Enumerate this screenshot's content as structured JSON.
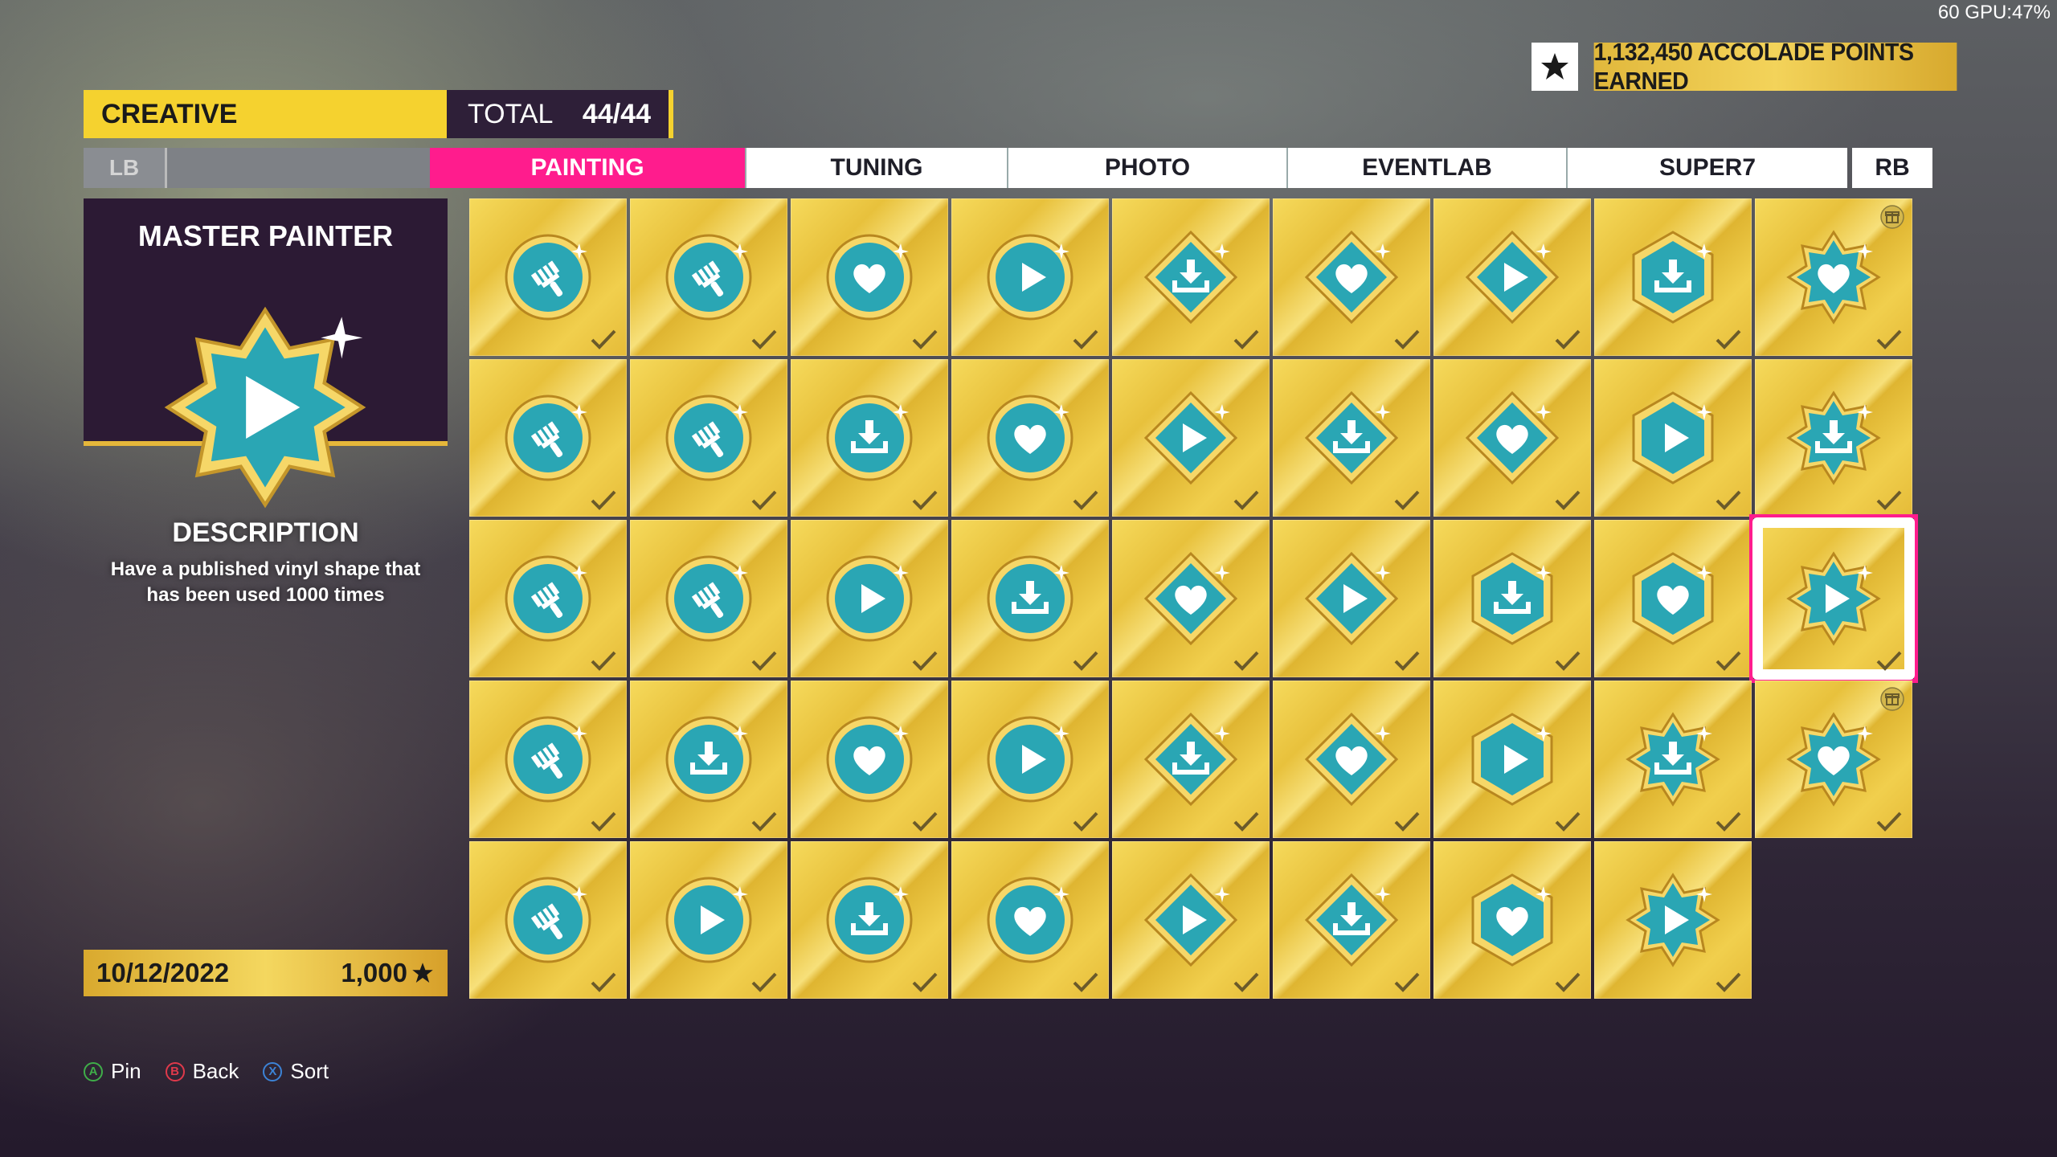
{
  "perf": "60 GPU:47%",
  "accolade": {
    "points": "1,132,450 ACCOLADE POINTS EARNED",
    "icon": "star-icon"
  },
  "category": {
    "name": "CREATIVE",
    "total_label": "TOTAL",
    "total_value": "44/44"
  },
  "tabs": {
    "left_bumper": "LB",
    "right_bumper": "RB",
    "items": [
      {
        "label": "PAINTING",
        "active": true
      },
      {
        "label": "TUNING",
        "active": false
      },
      {
        "label": "PHOTO",
        "active": false
      },
      {
        "label": "EVENTLAB",
        "active": false
      },
      {
        "label": "SUPER7",
        "active": false
      }
    ]
  },
  "detail": {
    "title": "MASTER PAINTER",
    "badge": {
      "shape": "star-hexagon",
      "icon": "play-icon"
    },
    "description_title": "DESCRIPTION",
    "description": "Have a published vinyl shape that has been used 1000 times",
    "date": "10/12/2022",
    "points": "1,000"
  },
  "colors": {
    "accent": "#ff1c8d",
    "gold": "#f5d22f",
    "badge": "#2aa6b4",
    "panel": "#2c1a34"
  },
  "grid": {
    "rows": [
      [
        {
          "shape": "circle",
          "icon": "brush",
          "complete": true
        },
        {
          "shape": "circle",
          "icon": "brush",
          "complete": true
        },
        {
          "shape": "circle",
          "icon": "heart",
          "complete": true
        },
        {
          "shape": "circle",
          "icon": "play",
          "complete": true
        },
        {
          "shape": "diamond",
          "icon": "download",
          "complete": true
        },
        {
          "shape": "diamond",
          "icon": "heart",
          "complete": true
        },
        {
          "shape": "diamond",
          "icon": "play",
          "complete": true
        },
        {
          "shape": "hexagon",
          "icon": "download",
          "complete": true
        },
        {
          "shape": "star",
          "icon": "heart",
          "complete": true,
          "gift": true
        }
      ],
      [
        {
          "shape": "circle",
          "icon": "brush",
          "complete": true
        },
        {
          "shape": "circle",
          "icon": "brush",
          "complete": true
        },
        {
          "shape": "circle",
          "icon": "download",
          "complete": true
        },
        {
          "shape": "circle",
          "icon": "heart",
          "complete": true
        },
        {
          "shape": "diamond",
          "icon": "play",
          "complete": true
        },
        {
          "shape": "diamond",
          "icon": "download",
          "complete": true
        },
        {
          "shape": "diamond",
          "icon": "heart",
          "complete": true
        },
        {
          "shape": "hexagon",
          "icon": "play",
          "complete": true
        },
        {
          "shape": "star",
          "icon": "download",
          "complete": true
        }
      ],
      [
        {
          "shape": "circle",
          "icon": "brush",
          "complete": true
        },
        {
          "shape": "circle",
          "icon": "brush",
          "complete": true
        },
        {
          "shape": "circle",
          "icon": "play",
          "complete": true
        },
        {
          "shape": "circle",
          "icon": "download",
          "complete": true
        },
        {
          "shape": "diamond",
          "icon": "heart",
          "complete": true
        },
        {
          "shape": "diamond",
          "icon": "play",
          "complete": true
        },
        {
          "shape": "hexagon",
          "icon": "download",
          "complete": true
        },
        {
          "shape": "hexagon",
          "icon": "heart",
          "complete": true
        },
        {
          "shape": "star",
          "icon": "play",
          "complete": true,
          "selected": true
        }
      ],
      [
        {
          "shape": "circle",
          "icon": "brush",
          "complete": true
        },
        {
          "shape": "circle",
          "icon": "download",
          "complete": true
        },
        {
          "shape": "circle",
          "icon": "heart",
          "complete": true
        },
        {
          "shape": "circle",
          "icon": "play",
          "complete": true
        },
        {
          "shape": "diamond",
          "icon": "download",
          "complete": true
        },
        {
          "shape": "diamond",
          "icon": "heart",
          "complete": true
        },
        {
          "shape": "hexagon",
          "icon": "play",
          "complete": true
        },
        {
          "shape": "star",
          "icon": "download",
          "complete": true
        },
        {
          "shape": "star",
          "icon": "heart",
          "complete": true,
          "gift": true
        }
      ],
      [
        {
          "shape": "circle",
          "icon": "brush",
          "complete": true
        },
        {
          "shape": "circle",
          "icon": "play",
          "complete": true
        },
        {
          "shape": "circle",
          "icon": "download",
          "complete": true
        },
        {
          "shape": "circle",
          "icon": "heart",
          "complete": true
        },
        {
          "shape": "diamond",
          "icon": "play",
          "complete": true
        },
        {
          "shape": "diamond",
          "icon": "download",
          "complete": true
        },
        {
          "shape": "hexagon",
          "icon": "heart",
          "complete": true
        },
        {
          "shape": "star",
          "icon": "play",
          "complete": true
        }
      ]
    ]
  },
  "hints": [
    {
      "button": "A",
      "label": "Pin",
      "color": "#3fae49"
    },
    {
      "button": "B",
      "label": "Back",
      "color": "#e0394b"
    },
    {
      "button": "X",
      "label": "Sort",
      "color": "#3c83d6"
    }
  ]
}
